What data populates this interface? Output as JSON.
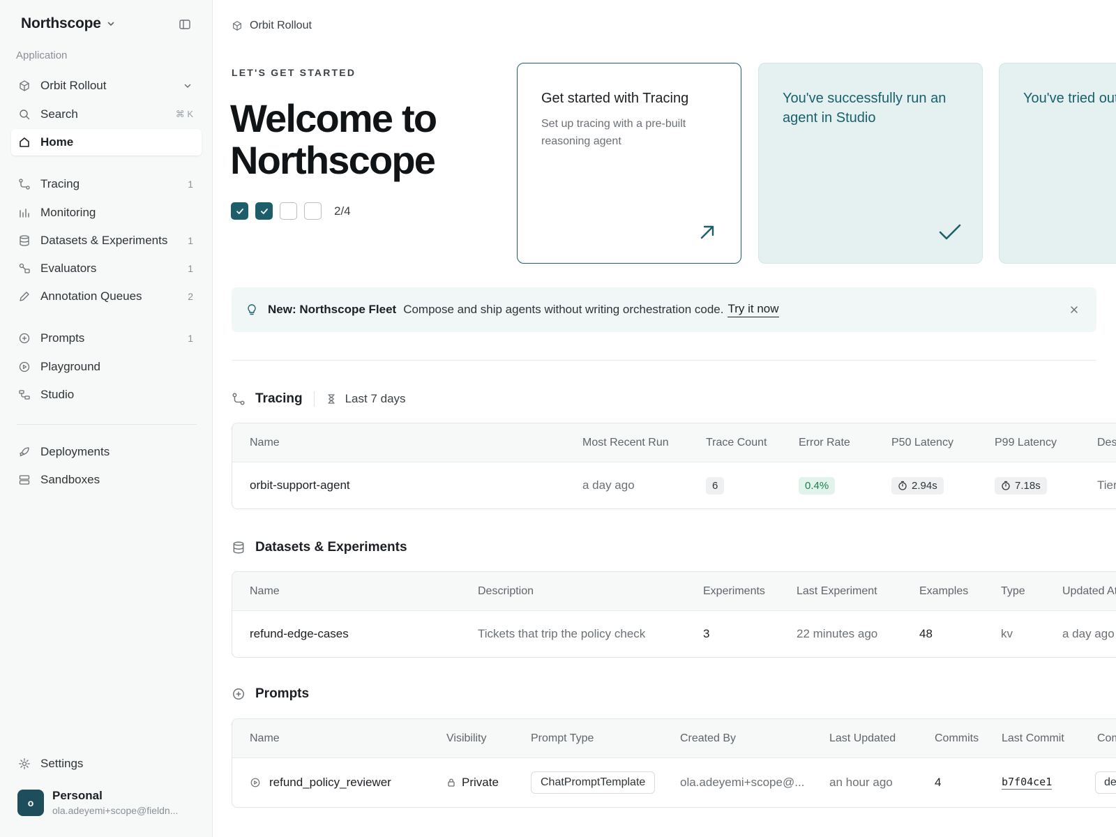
{
  "workspace": {
    "name": "Northscope"
  },
  "sidebar": {
    "section_label": "Application",
    "project": {
      "label": "Orbit Rollout"
    },
    "search": {
      "label": "Search",
      "shortcut": "⌘ K"
    },
    "home": {
      "label": "Home"
    },
    "items": [
      {
        "label": "Tracing",
        "count": "1"
      },
      {
        "label": "Monitoring",
        "count": ""
      },
      {
        "label": "Datasets & Experiments",
        "count": "1"
      },
      {
        "label": "Evaluators",
        "count": "1"
      },
      {
        "label": "Annotation Queues",
        "count": "2"
      },
      {
        "label": "Prompts",
        "count": "1"
      },
      {
        "label": "Playground",
        "count": ""
      },
      {
        "label": "Studio",
        "count": ""
      },
      {
        "label": "Deployments",
        "count": ""
      },
      {
        "label": "Sandboxes",
        "count": ""
      }
    ],
    "settings": {
      "label": "Settings"
    },
    "profile": {
      "initial": "o",
      "name": "Personal",
      "email": "ola.adeyemi+scope@fieldn..."
    }
  },
  "breadcrumb": {
    "project": "Orbit Rollout"
  },
  "hero": {
    "eyebrow": "LET'S GET STARTED",
    "title": "Welcome to Northscope",
    "progress": {
      "done": 2,
      "total": 4,
      "label": "2/4"
    }
  },
  "cards": [
    {
      "title": "Get started with Tracing",
      "description": "Set up tracing with a pre-built reasoning agent",
      "state": "open"
    },
    {
      "title": "You've successfully run an agent in Studio",
      "description": "",
      "state": "done"
    },
    {
      "title": "You've tried out Playground",
      "description": "",
      "state": "done"
    }
  ],
  "banner": {
    "title": "New: Northscope Fleet",
    "text": "Compose and ship agents without writing orchestration code.",
    "link": "Try it now"
  },
  "tracing": {
    "title": "Tracing",
    "range": "Last 7 days",
    "columns": [
      "Name",
      "Most Recent Run",
      "Trace Count",
      "Error Rate",
      "P50 Latency",
      "P99 Latency",
      "Description"
    ],
    "rows": [
      {
        "name": "orbit-support-agent",
        "recent": "a day ago",
        "count": "6",
        "error": "0.4%",
        "p50": "2.94s",
        "p99": "7.18s",
        "desc": "Tier"
      }
    ]
  },
  "datasets": {
    "title": "Datasets & Experiments",
    "columns": [
      "Name",
      "Description",
      "Experiments",
      "Last Experiment",
      "Examples",
      "Type",
      "Updated At"
    ],
    "rows": [
      {
        "name": "refund-edge-cases",
        "description": "Tickets that trip the policy check",
        "experiments": "3",
        "last": "22 minutes ago",
        "examples": "48",
        "type": "kv",
        "updated": "a day ago"
      }
    ]
  },
  "prompts": {
    "title": "Prompts",
    "columns": [
      "Name",
      "Visibility",
      "Prompt Type",
      "Created By",
      "Last Updated",
      "Commits",
      "Last Commit",
      "Commit"
    ],
    "rows": [
      {
        "name": "refund_policy_reviewer",
        "visibility": "Private",
        "type": "ChatPromptTemplate",
        "created_by": "ola.adeyemi+scope@...",
        "updated": "an hour ago",
        "commits": "4",
        "last_commit": "b7f04ce1",
        "commit_tag": "de"
      }
    ]
  },
  "colors": {
    "accent": "#1e5e6b",
    "accent_soft": "#e4f1f0",
    "success": "#1b7f4f"
  }
}
